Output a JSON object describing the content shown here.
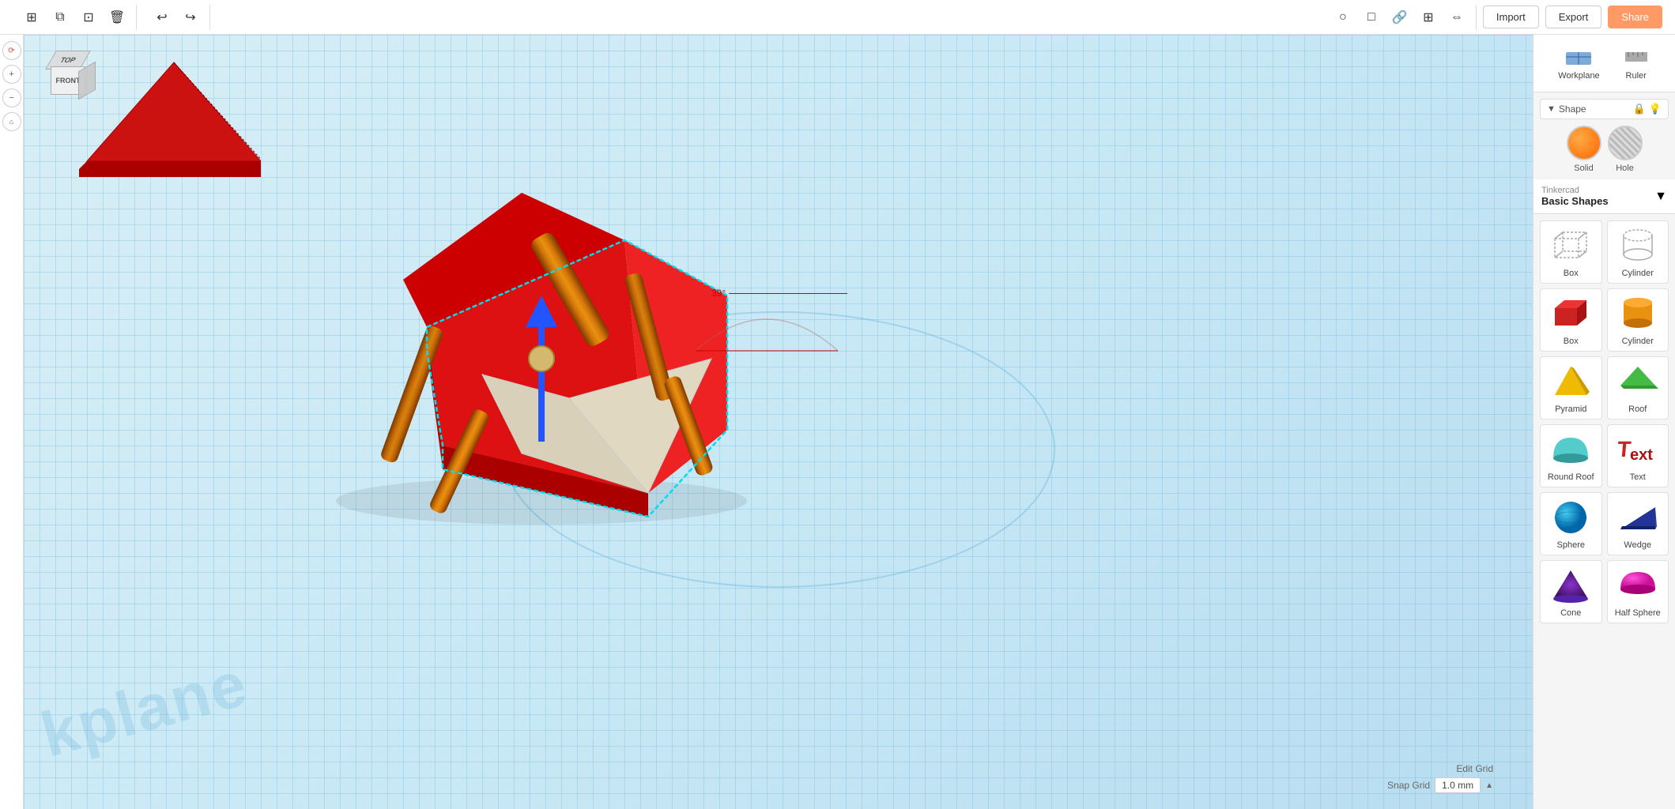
{
  "toolbar": {
    "buttons": [
      "new",
      "copy",
      "duplicate",
      "delete",
      "undo",
      "redo"
    ],
    "icons": {
      "new": "⊞",
      "copy": "⧉",
      "duplicate": "⊡",
      "delete": "🗑",
      "undo": "↩",
      "redo": "↪"
    },
    "right_icons": [
      "circle",
      "square",
      "link",
      "grid",
      "mirror"
    ],
    "import_label": "Import",
    "export_label": "Export",
    "share_label": "Share"
  },
  "left_panel": {
    "buttons": [
      "rotate",
      "zoom_in",
      "zoom_out",
      "home"
    ]
  },
  "viewport": {
    "workplane_label": "kplane",
    "measurement_angle": "39°",
    "edit_grid_label": "Edit Grid",
    "snap_grid_label": "Snap Grid",
    "snap_value": "1.0 mm"
  },
  "cube_nav": {
    "top_label": "TOP",
    "front_label": "FRONT",
    "right_label": ""
  },
  "right_panel": {
    "tabs": [
      {
        "id": "workplane",
        "label": "Workplane"
      },
      {
        "id": "ruler",
        "label": "Ruler"
      }
    ],
    "tinkercad_label": "Tinkercad",
    "shapes_title": "Basic Shapes",
    "shapes_dropdown": "▼",
    "shape_panel_label": "Shape",
    "solid_label": "Solid",
    "hole_label": "Hole",
    "shapes": [
      {
        "id": "box-wire",
        "label": "Box",
        "color": "#aaa",
        "type": "box-wire"
      },
      {
        "id": "cylinder-wire",
        "label": "Cylinder",
        "color": "#aaa",
        "type": "cylinder-wire"
      },
      {
        "id": "box-red",
        "label": "Box",
        "color": "#cc2222",
        "type": "box-solid"
      },
      {
        "id": "cylinder-orange",
        "label": "Cylinder",
        "color": "#e8880a",
        "type": "cylinder-solid"
      },
      {
        "id": "pyramid",
        "label": "Pyramid",
        "color": "#eebb00",
        "type": "pyramid"
      },
      {
        "id": "roof",
        "label": "Roof",
        "color": "#44bb44",
        "type": "roof"
      },
      {
        "id": "round-roof",
        "label": "Round Roof",
        "color": "#55cccc",
        "type": "round-roof"
      },
      {
        "id": "text",
        "label": "Text",
        "color": "#cc2222",
        "type": "text-3d"
      },
      {
        "id": "sphere",
        "label": "Sphere",
        "color": "#1199cc",
        "type": "sphere"
      },
      {
        "id": "wedge",
        "label": "Wedge",
        "color": "#223399",
        "type": "wedge"
      },
      {
        "id": "cone",
        "label": "Cone",
        "color": "#6622aa",
        "type": "cone"
      },
      {
        "id": "half-sphere",
        "label": "Half Sphere",
        "color": "#cc22aa",
        "type": "half-sphere"
      }
    ]
  }
}
